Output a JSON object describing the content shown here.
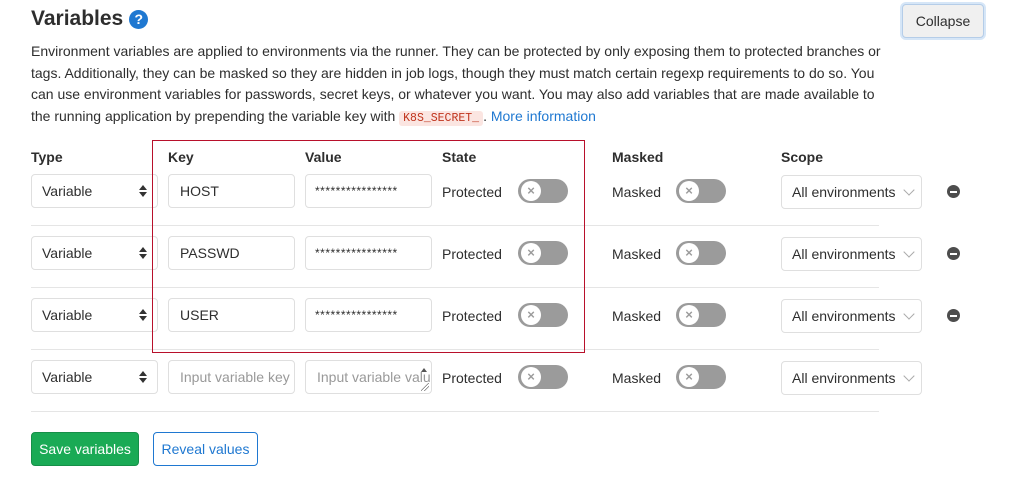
{
  "header": {
    "title": "Variables",
    "help_glyph": "?",
    "collapse_label": "Collapse"
  },
  "description": {
    "text_before_code": "Environment variables are applied to environments via the runner. They can be protected by only exposing them to protected branches or tags. Additionally, they can be masked so they are hidden in job logs, though they must match certain regexp requirements to do so. You can use environment variables for passwords, secret keys, or whatever you want. You may also add variables that are made available to the running application by prepending the variable key with ",
    "code": "K8S_SECRET_",
    "text_after_code": ". ",
    "link": "More information"
  },
  "columns": {
    "type": "Type",
    "key": "Key",
    "value": "Value",
    "state": "State",
    "masked": "Masked",
    "scope": "Scope"
  },
  "rows": [
    {
      "type": "Variable",
      "key": "HOST",
      "value": "****************",
      "state": "Protected",
      "masked": "Masked",
      "scope": "All environments",
      "protected_on": false,
      "masked_on": false
    },
    {
      "type": "Variable",
      "key": "PASSWD",
      "value": "****************",
      "state": "Protected",
      "masked": "Masked",
      "scope": "All environments",
      "protected_on": false,
      "masked_on": false
    },
    {
      "type": "Variable",
      "key": "USER",
      "value": "****************",
      "state": "Protected",
      "masked": "Masked",
      "scope": "All environments",
      "protected_on": false,
      "masked_on": false
    }
  ],
  "new_row": {
    "type": "Variable",
    "key_placeholder": "Input variable key",
    "value_placeholder": "Input variable value",
    "state": "Protected",
    "masked": "Masked",
    "scope": "All environments"
  },
  "toggle_glyph": "×",
  "actions": {
    "save": "Save variables",
    "reveal": "Reveal values"
  },
  "colors": {
    "primary_green": "#1aaa55",
    "link_blue": "#1f78d1",
    "toggle_off": "#9b9b9b",
    "highlight_border": "#b8102b"
  }
}
